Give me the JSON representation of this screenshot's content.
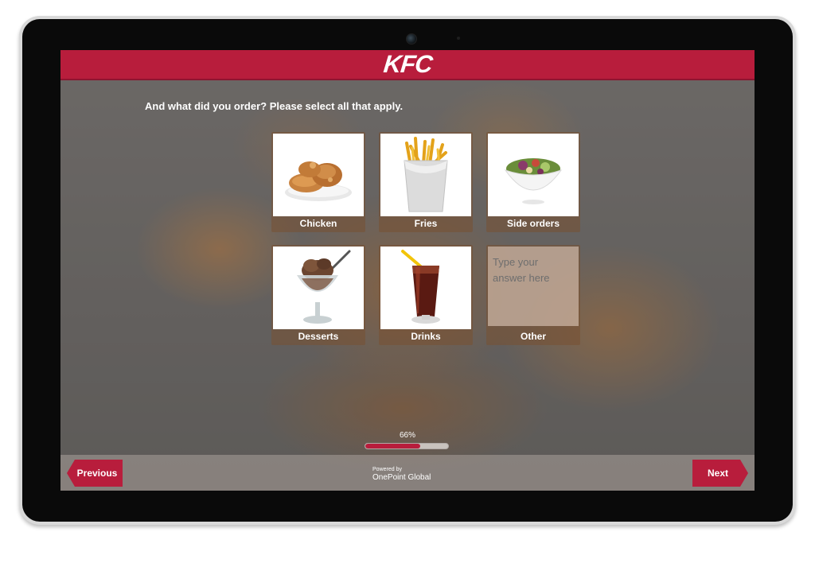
{
  "header": {
    "logo_text": "KFC",
    "brand_color": "#b81d3c"
  },
  "survey": {
    "question": "And what did you order? Please select all that apply.",
    "options": [
      {
        "label": "Chicken",
        "icon": "fried-chicken-icon"
      },
      {
        "label": "Fries",
        "icon": "fries-icon"
      },
      {
        "label": "Side orders",
        "icon": "salad-bowl-icon"
      },
      {
        "label": "Desserts",
        "icon": "sundae-icon"
      },
      {
        "label": "Drinks",
        "icon": "soda-glass-icon"
      },
      {
        "label": "Other",
        "placeholder": "Type your answer here"
      }
    ]
  },
  "progress": {
    "label": "66%",
    "value": 0.66
  },
  "footer": {
    "previous_label": "Previous",
    "next_label": "Next",
    "powered_by": "Powered by",
    "brand": "OnePoint Global"
  }
}
